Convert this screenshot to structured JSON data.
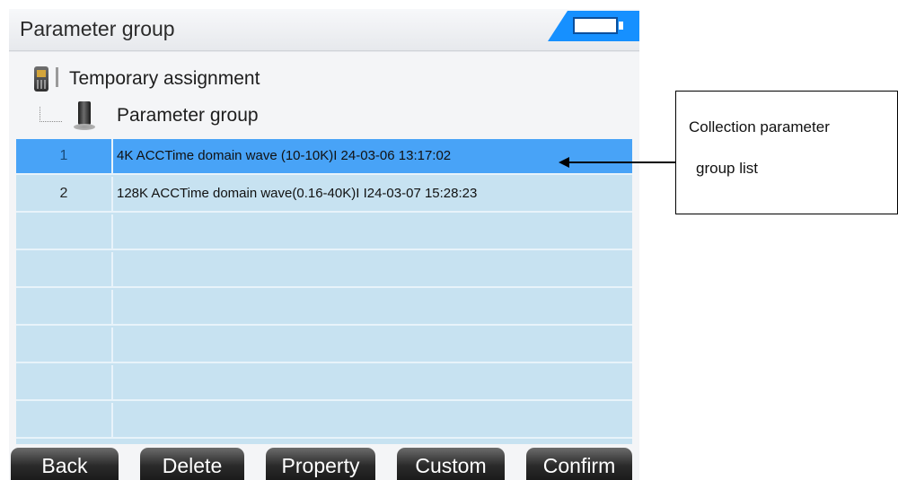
{
  "header": {
    "title": "Parameter group",
    "battery_icon": "battery-icon",
    "accent_color": "#1690ff"
  },
  "tree": {
    "root_label": "Temporary assignment",
    "root_icon": "handheld-device-icon",
    "child_label": "Parameter group",
    "child_icon": "sensor-icon"
  },
  "table": {
    "selected_color": "#48a3f7",
    "row_color": "#c7e2f1",
    "rows": [
      {
        "index": "1",
        "text": "4K ACCTime domain wave  (10-10K)I 24-03-06 13:17:02",
        "selected": true
      },
      {
        "index": "2",
        "text": "128K ACCTime domain wave(0.16-40K)I I24-03-07 15:28:23",
        "selected": false
      },
      {
        "index": "",
        "text": "",
        "selected": false
      },
      {
        "index": "",
        "text": "",
        "selected": false
      },
      {
        "index": "",
        "text": "",
        "selected": false
      },
      {
        "index": "",
        "text": "",
        "selected": false
      },
      {
        "index": "",
        "text": "",
        "selected": false
      },
      {
        "index": "",
        "text": "",
        "selected": false
      }
    ]
  },
  "buttons": {
    "back": "Back",
    "delete": "Delete",
    "property": "Property",
    "custom": "Custom",
    "confirm": "Confirm"
  },
  "callout": {
    "line1": "Collection parameter",
    "line2": "group list"
  }
}
